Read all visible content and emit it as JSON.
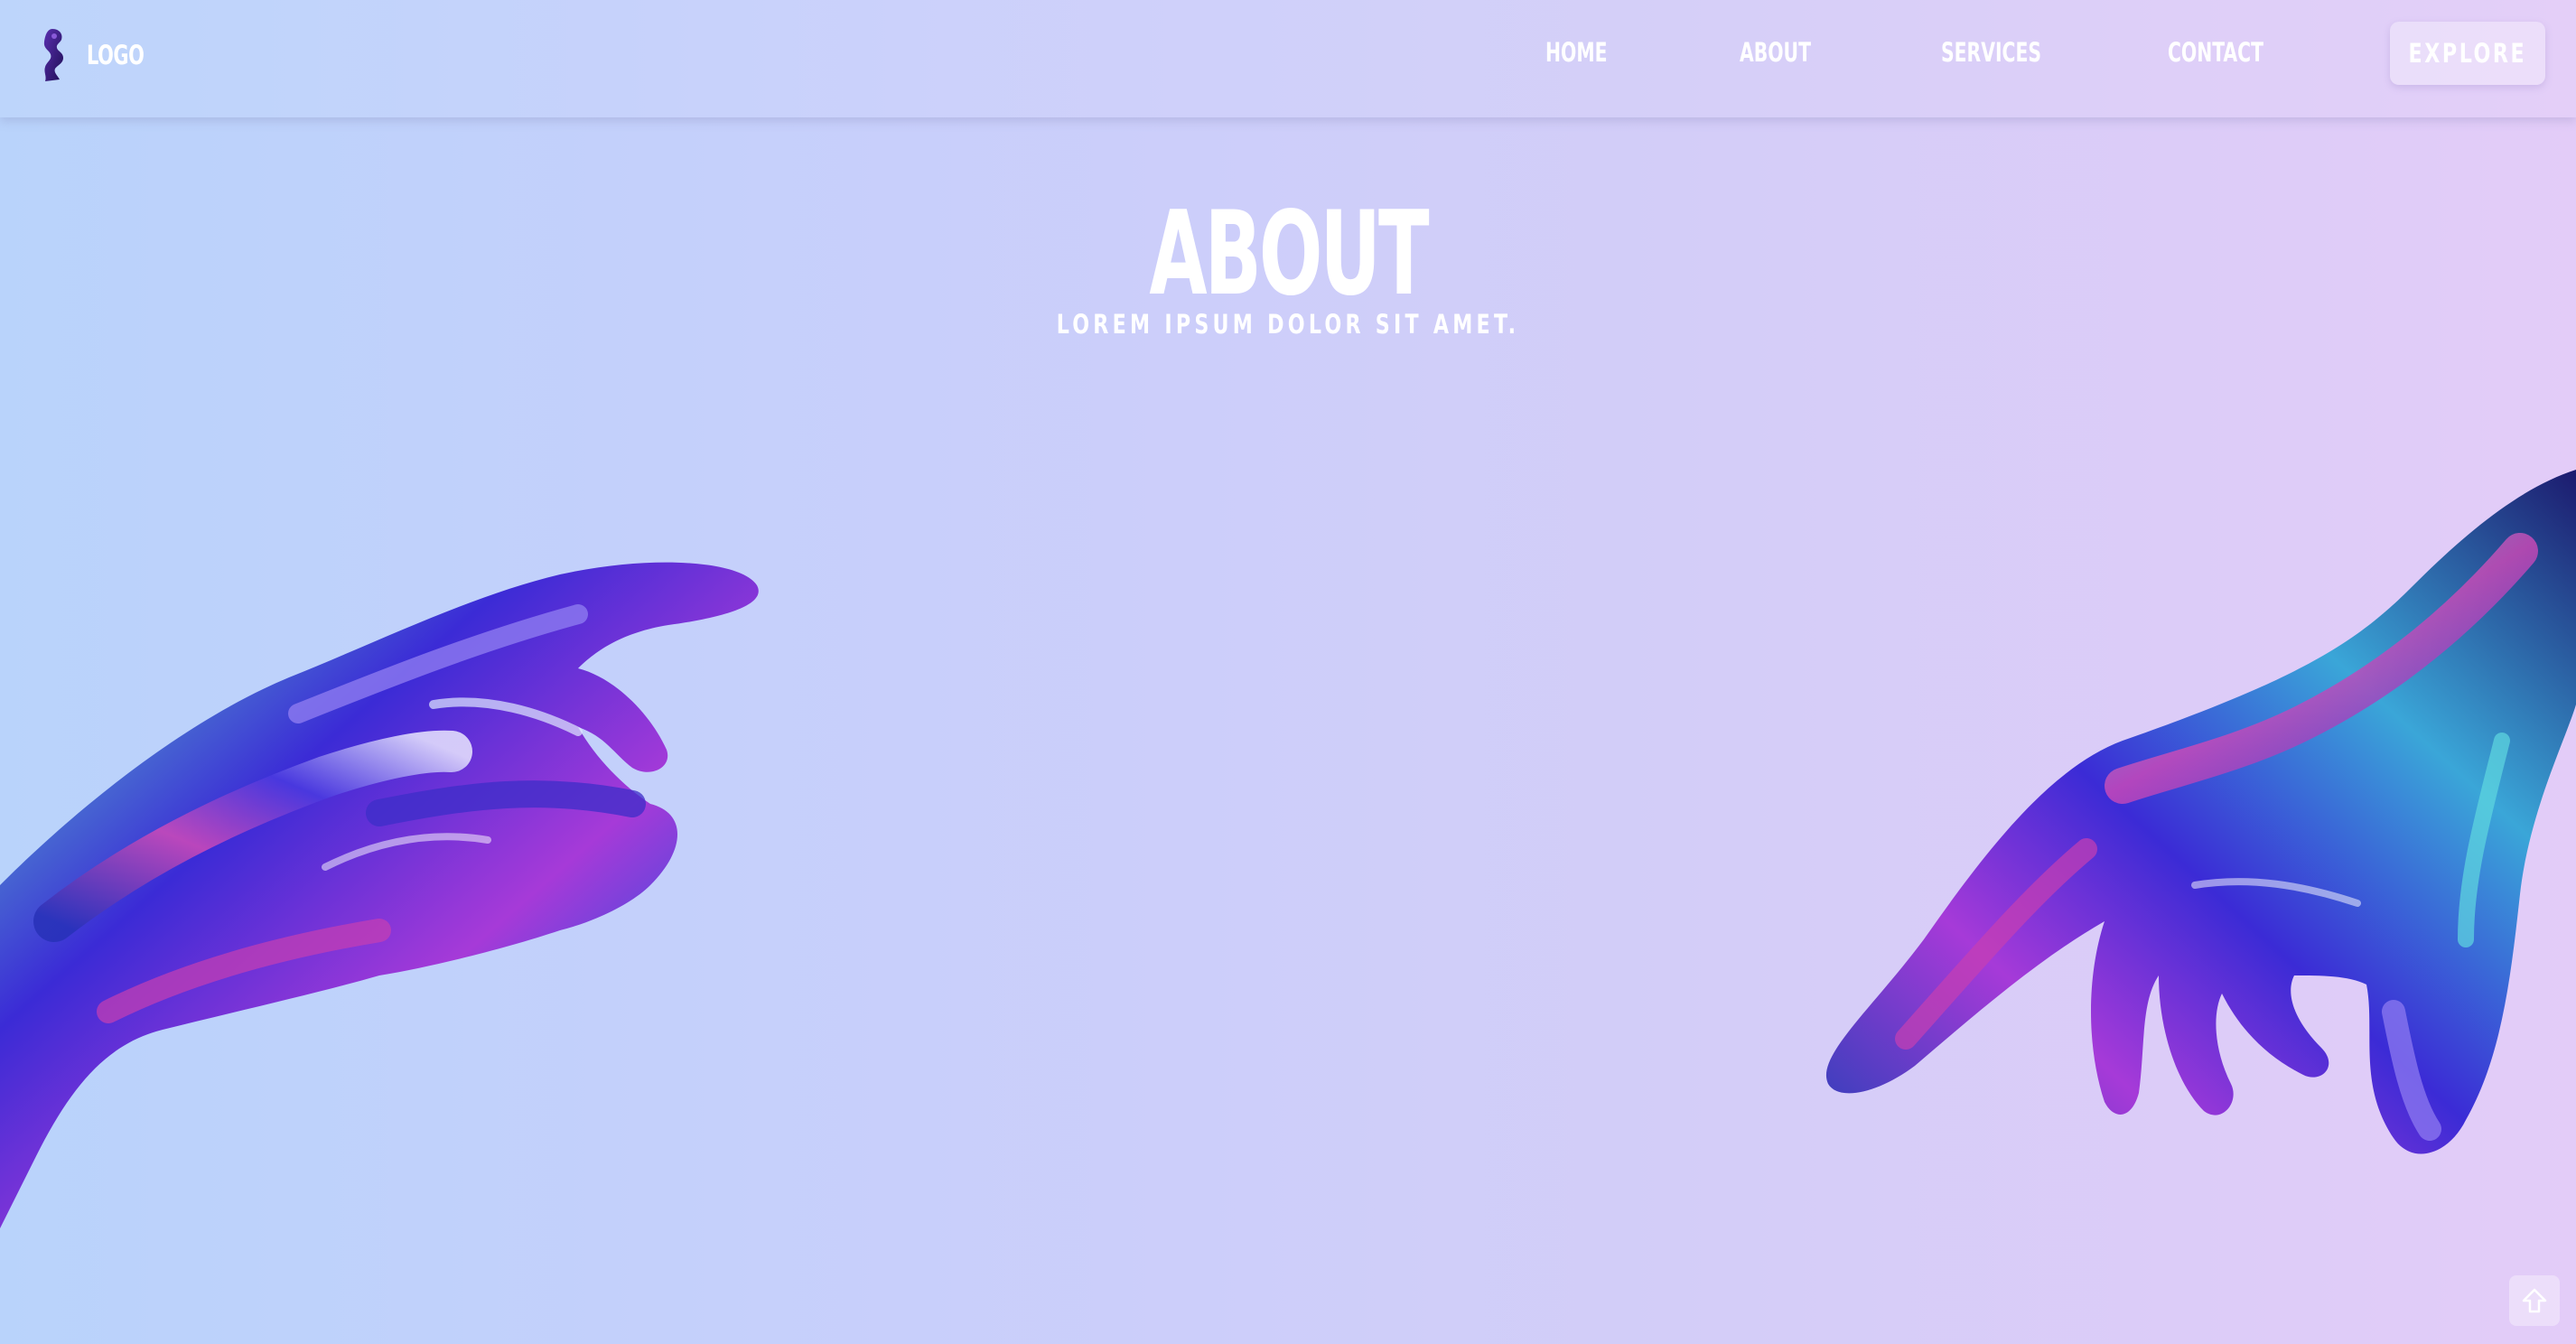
{
  "header": {
    "logo": {
      "icon": "figure-logo-icon",
      "label": "LOGO"
    },
    "nav": [
      {
        "label": "HOME"
      },
      {
        "label": "ABOUT"
      },
      {
        "label": "SERVICES"
      },
      {
        "label": "CONTACT"
      }
    ],
    "cta_label": "EXPLORE"
  },
  "hero": {
    "title": "ABOUT",
    "subtitle": "LOREM IPSUM DOLOR SIT AMET."
  },
  "decor": {
    "left_image": "iridescent-hand-left",
    "right_image": "iridescent-hand-right"
  },
  "scroll_top": {
    "icon": "arrow-up-icon"
  },
  "colors": {
    "background_start": "#b9d3fb",
    "background_end": "#e3ccf8",
    "text": "#ffffff",
    "logo": "#3a1d7a"
  }
}
